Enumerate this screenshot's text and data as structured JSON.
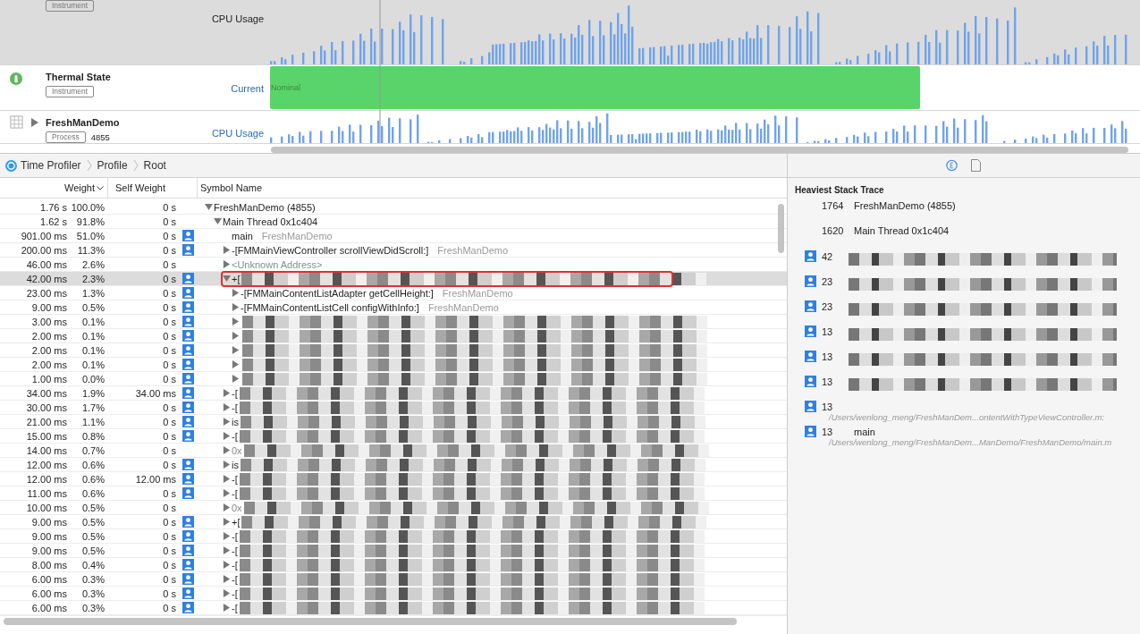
{
  "tracks": [
    {
      "kind": "cpu",
      "selected": true,
      "badge": "Instrument",
      "metric": "CPU Usage"
    },
    {
      "kind": "thermal",
      "selected": false,
      "title": "Thermal State",
      "badge": "Instrument",
      "metric": "Current",
      "state": "Nominal"
    },
    {
      "kind": "process",
      "selected": false,
      "title": "FreshManDemo",
      "badge": "Process",
      "pid": "4855",
      "metric": "CPU Usage"
    }
  ],
  "breadcrumb": [
    "Time Profiler",
    "Profile",
    "Root"
  ],
  "call_tree": {
    "columns": [
      "Weight",
      "Self Weight",
      "Symbol Name"
    ],
    "rows": [
      {
        "kind": "group",
        "expanded": true,
        "selected": false,
        "weight": "1.76 s",
        "percent": "100.0%",
        "self_weight": "0 s",
        "user_code": false,
        "redacted": false,
        "symbol": "FreshManDemo (4855)",
        "children": [
          {
            "kind": "group",
            "expanded": true,
            "selected": false,
            "weight": "1.62 s",
            "percent": "91.8%",
            "self_weight": "0 s",
            "user_code": false,
            "redacted": false,
            "symbol": "Main Thread  0x1c404",
            "children": [
              {
                "kind": "leaf",
                "selected": false,
                "weight": "901.00 ms",
                "percent": "51.0%",
                "self_weight": "0 s",
                "user_code": true,
                "redacted": false,
                "symbol": "main",
                "library": "FreshManDemo"
              },
              {
                "kind": "group",
                "expanded": false,
                "selected": false,
                "weight": "200.00 ms",
                "percent": "11.3%",
                "self_weight": "0 s",
                "user_code": true,
                "redacted": false,
                "symbol": "-[FMMainViewController scrollViewDidScroll:]",
                "library": "FreshManDemo"
              },
              {
                "kind": "group",
                "expanded": false,
                "selected": false,
                "weight": "46.00 ms",
                "percent": "2.6%",
                "self_weight": "0 s",
                "user_code": false,
                "redacted": false,
                "dimmed": true,
                "symbol": "<Unknown Address>"
              },
              {
                "kind": "group",
                "expanded": true,
                "selected": true,
                "weight": "42.00 ms",
                "percent": "2.3%",
                "self_weight": "0 s",
                "user_code": true,
                "redacted": true,
                "symbol": "+[",
                "children": [
                  {
                    "kind": "group",
                    "expanded": false,
                    "selected": false,
                    "weight": "23.00 ms",
                    "percent": "1.3%",
                    "self_weight": "0 s",
                    "user_code": true,
                    "redacted": false,
                    "symbol": "-[FMMainContentListAdapter getCellHeight:]",
                    "library": "FreshManDemo"
                  },
                  {
                    "kind": "group",
                    "expanded": false,
                    "selected": false,
                    "weight": "9.00 ms",
                    "percent": "0.5%",
                    "self_weight": "0 s",
                    "user_code": true,
                    "redacted": false,
                    "symbol": "-[FMMainContentListCell configWithInfo:]",
                    "library": "FreshManDemo"
                  },
                  {
                    "kind": "group",
                    "expanded": false,
                    "selected": false,
                    "weight": "3.00 ms",
                    "percent": "0.1%",
                    "self_weight": "0 s",
                    "user_code": true,
                    "redacted": true
                  },
                  {
                    "kind": "group",
                    "expanded": false,
                    "selected": false,
                    "weight": "2.00 ms",
                    "percent": "0.1%",
                    "self_weight": "0 s",
                    "user_code": true,
                    "redacted": true
                  },
                  {
                    "kind": "group",
                    "expanded": false,
                    "selected": false,
                    "weight": "2.00 ms",
                    "percent": "0.1%",
                    "self_weight": "0 s",
                    "user_code": true,
                    "redacted": true
                  },
                  {
                    "kind": "group",
                    "expanded": false,
                    "selected": false,
                    "weight": "2.00 ms",
                    "percent": "0.1%",
                    "self_weight": "0 s",
                    "user_code": true,
                    "redacted": true
                  },
                  {
                    "kind": "group",
                    "expanded": false,
                    "selected": false,
                    "weight": "1.00 ms",
                    "percent": "0.0%",
                    "self_weight": "0 s",
                    "user_code": true,
                    "redacted": true
                  }
                ]
              },
              {
                "kind": "group",
                "expanded": false,
                "selected": false,
                "weight": "34.00 ms",
                "percent": "1.9%",
                "self_weight": "34.00 ms",
                "user_code": true,
                "redacted": true,
                "symbol": "-["
              },
              {
                "kind": "group",
                "expanded": false,
                "selected": false,
                "weight": "30.00 ms",
                "percent": "1.7%",
                "self_weight": "0 s",
                "user_code": true,
                "redacted": true,
                "symbol": "-["
              },
              {
                "kind": "group",
                "expanded": false,
                "selected": false,
                "weight": "21.00 ms",
                "percent": "1.1%",
                "self_weight": "0 s",
                "user_code": true,
                "redacted": true,
                "symbol": "is"
              },
              {
                "kind": "group",
                "expanded": false,
                "selected": false,
                "weight": "15.00 ms",
                "percent": "0.8%",
                "self_weight": "0 s",
                "user_code": true,
                "redacted": true,
                "symbol": "-["
              },
              {
                "kind": "group",
                "expanded": false,
                "selected": false,
                "weight": "14.00 ms",
                "percent": "0.7%",
                "self_weight": "0 s",
                "user_code": false,
                "redacted": true,
                "dimmed": true,
                "symbol": "0x"
              },
              {
                "kind": "group",
                "expanded": false,
                "selected": false,
                "weight": "12.00 ms",
                "percent": "0.6%",
                "self_weight": "0 s",
                "user_code": true,
                "redacted": true,
                "symbol": "is"
              },
              {
                "kind": "group",
                "expanded": false,
                "selected": false,
                "weight": "12.00 ms",
                "percent": "0.6%",
                "self_weight": "12.00 ms",
                "user_code": true,
                "redacted": true,
                "symbol": "-["
              },
              {
                "kind": "group",
                "expanded": false,
                "selected": false,
                "weight": "11.00 ms",
                "percent": "0.6%",
                "self_weight": "0 s",
                "user_code": true,
                "redacted": true,
                "symbol": "-["
              },
              {
                "kind": "group",
                "expanded": false,
                "selected": false,
                "weight": "10.00 ms",
                "percent": "0.5%",
                "self_weight": "0 s",
                "user_code": false,
                "redacted": true,
                "dimmed": true,
                "symbol": "0x"
              },
              {
                "kind": "group",
                "expanded": false,
                "selected": false,
                "weight": "9.00 ms",
                "percent": "0.5%",
                "self_weight": "0 s",
                "user_code": true,
                "redacted": true,
                "symbol": "+["
              },
              {
                "kind": "group",
                "expanded": false,
                "selected": false,
                "weight": "9.00 ms",
                "percent": "0.5%",
                "self_weight": "0 s",
                "user_code": true,
                "redacted": true,
                "symbol": "-["
              },
              {
                "kind": "group",
                "expanded": false,
                "selected": false,
                "weight": "9.00 ms",
                "percent": "0.5%",
                "self_weight": "0 s",
                "user_code": true,
                "redacted": true,
                "symbol": "-["
              },
              {
                "kind": "group",
                "expanded": false,
                "selected": false,
                "weight": "8.00 ms",
                "percent": "0.4%",
                "self_weight": "0 s",
                "user_code": true,
                "redacted": true,
                "symbol": "-["
              },
              {
                "kind": "group",
                "expanded": false,
                "selected": false,
                "weight": "6.00 ms",
                "percent": "0.3%",
                "self_weight": "0 s",
                "user_code": true,
                "redacted": true,
                "symbol": "-["
              },
              {
                "kind": "group",
                "expanded": false,
                "selected": false,
                "weight": "6.00 ms",
                "percent": "0.3%",
                "self_weight": "0 s",
                "user_code": true,
                "redacted": true,
                "symbol": "-["
              },
              {
                "kind": "group",
                "expanded": false,
                "selected": false,
                "weight": "6.00 ms",
                "percent": "0.3%",
                "self_weight": "0 s",
                "user_code": true,
                "redacted": true,
                "symbol": "-["
              }
            ]
          }
        ]
      }
    ]
  },
  "stack_trace": {
    "title": "Heaviest Stack Trace",
    "frames": [
      {
        "count": "1764",
        "symbol": "FreshManDemo (4855)",
        "user_code": false,
        "redacted": false
      },
      {
        "count": "1620",
        "symbol": "Main Thread  0x1c404",
        "user_code": false,
        "redacted": false
      },
      {
        "count": "42",
        "user_code": true,
        "redacted": true
      },
      {
        "count": "23",
        "user_code": true,
        "redacted": true
      },
      {
        "count": "23",
        "user_code": true,
        "redacted": true
      },
      {
        "count": "13",
        "user_code": true,
        "redacted": true
      },
      {
        "count": "13",
        "user_code": true,
        "redacted": true
      },
      {
        "count": "13",
        "user_code": true,
        "redacted": true
      },
      {
        "count": "13",
        "user_code": true,
        "redacted": true,
        "path": "/Users/wenlong_meng/FreshManDem...ontentWithTypeViewController.m:"
      },
      {
        "count": "13",
        "symbol": "main",
        "user_code": true,
        "redacted": false,
        "path": "/Users/wenlong_meng/FreshManDem...ManDemo/FreshManDemo/main.m"
      }
    ]
  }
}
